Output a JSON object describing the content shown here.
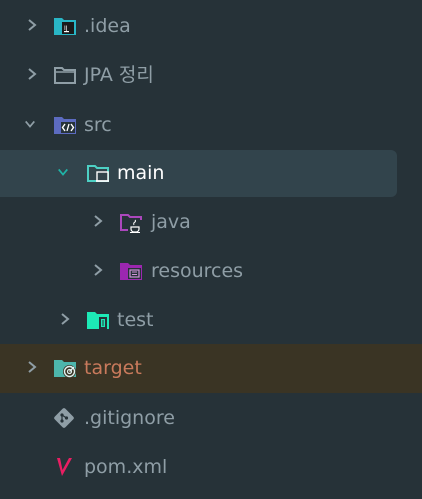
{
  "tree": {
    "items": [
      {
        "label": ".idea",
        "icon": "idea-folder-icon",
        "expanded": false
      },
      {
        "label": "JPA 정리",
        "icon": "folder-icon",
        "expanded": false
      },
      {
        "label": "src",
        "icon": "source-folder-icon",
        "expanded": true
      },
      {
        "label": "main",
        "icon": "main-folder-icon",
        "expanded": true,
        "selected": true
      },
      {
        "label": "java",
        "icon": "java-folder-icon",
        "expanded": false
      },
      {
        "label": "resources",
        "icon": "resources-folder-icon",
        "expanded": false
      },
      {
        "label": "test",
        "icon": "test-folder-icon",
        "expanded": false
      },
      {
        "label": "target",
        "icon": "target-folder-icon",
        "expanded": false,
        "excluded": true
      },
      {
        "label": ".gitignore",
        "icon": "git-icon"
      },
      {
        "label": "pom.xml",
        "icon": "maven-icon"
      }
    ]
  },
  "colors": {
    "background": "#263238",
    "selected_row": "#32444c",
    "excluded_row": "#3a3424",
    "text": "#8f9ea6",
    "selected_text": "#ffffff",
    "excluded_text": "#c97a5c",
    "chevron_expanded": "#1fb5a8",
    "chevron_collapsed": "#8f9ea6"
  }
}
